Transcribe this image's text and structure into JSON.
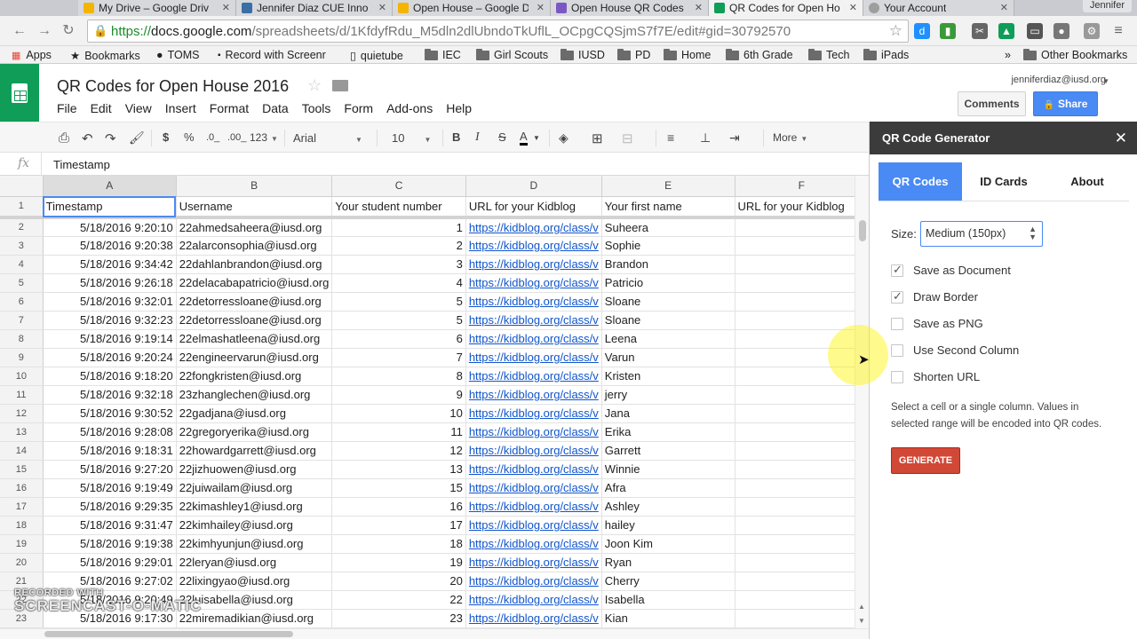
{
  "browser": {
    "tabs": [
      {
        "label": "My Drive – Google Driv",
        "color": "#f4b400"
      },
      {
        "label": "Jennifer Diaz CUE Inno",
        "color": "#3a6ea5"
      },
      {
        "label": "Open House – Google D",
        "color": "#f4b400"
      },
      {
        "label": "Open House QR Codes",
        "color": "#7b57c4"
      },
      {
        "label": "QR Codes for Open Ho",
        "color": "#0f9d58"
      },
      {
        "label": "Your Account",
        "color": "#9e9e9e"
      }
    ],
    "profile": "Jennifer",
    "url": {
      "scheme": "https://",
      "host": "docs.google.com",
      "path": "/spreadsheets/d/1KfdyfRdu_M5dln2dlUbndoTkUflL_OCpgCQSjmS7f7E/edit#gid=30792570"
    },
    "bookmarks": [
      "Apps",
      "Bookmarks",
      "TOMS",
      "Record with Screenr",
      "quietube",
      "IEC",
      "Girl Scouts",
      "IUSD",
      "PD",
      "Home",
      "6th Grade",
      "Tech",
      "iPads"
    ],
    "other_bookmarks": "Other Bookmarks",
    "overflow": "»"
  },
  "sheets": {
    "title": "QR Codes for Open House 2016",
    "menu": [
      "File",
      "Edit",
      "View",
      "Insert",
      "Format",
      "Data",
      "Tools",
      "Form",
      "Add-ons",
      "Help"
    ],
    "account": "jenniferdiaz@iusd.org",
    "comments": "Comments",
    "share": "Share",
    "toolbar": {
      "currency": "$",
      "percent": "%",
      "dec_less": ".0_",
      "dec_more": ".00_",
      "number_format": "123",
      "font": "Arial",
      "font_size": "10",
      "bold": "B",
      "italic": "I",
      "strike": "S",
      "text_color": "A",
      "more": "More"
    },
    "formula_label": "fx",
    "formula_value": "Timestamp",
    "columns": [
      "A",
      "B",
      "C",
      "D",
      "E",
      "F"
    ],
    "header_row": [
      "Timestamp",
      "Username",
      "Your student number",
      "URL for  your Kidblog",
      "Your first name",
      "URL for  your Kidblog"
    ],
    "rows": [
      {
        "n": "2",
        "ts": "5/18/2016 9:20:10",
        "user": "22ahmedsaheera@iusd.org",
        "num": "1",
        "url": "https://kidblog.org/class/v",
        "first": "Suheera"
      },
      {
        "n": "3",
        "ts": "5/18/2016 9:20:38",
        "user": "22alarconsophia@iusd.org",
        "num": "2",
        "url": "https://kidblog.org/class/v",
        "first": "Sophie"
      },
      {
        "n": "4",
        "ts": "5/18/2016 9:34:42",
        "user": "22dahlanbrandon@iusd.org",
        "num": "3",
        "url": "https://kidblog.org/class/v",
        "first": "Brandon"
      },
      {
        "n": "5",
        "ts": "5/18/2016 9:26:18",
        "user": "22delacabapatricio@iusd.org",
        "num": "4",
        "url": "https://kidblog.org/class/v",
        "first": "Patricio"
      },
      {
        "n": "6",
        "ts": "5/18/2016 9:32:01",
        "user": "22detorressloane@iusd.org",
        "num": "5",
        "url": "https://kidblog.org/class/v",
        "first": "Sloane"
      },
      {
        "n": "7",
        "ts": "5/18/2016 9:32:23",
        "user": "22detorressloane@iusd.org",
        "num": "5",
        "url": "https://kidblog.org/class/v",
        "first": "Sloane"
      },
      {
        "n": "8",
        "ts": "5/18/2016 9:19:14",
        "user": "22elmashatleena@iusd.org",
        "num": "6",
        "url": "https://kidblog.org/class/v",
        "first": "Leena"
      },
      {
        "n": "9",
        "ts": "5/18/2016 9:20:24",
        "user": "22engineervarun@iusd.org",
        "num": "7",
        "url": "https://kidblog.org/class/v",
        "first": "Varun"
      },
      {
        "n": "10",
        "ts": "5/18/2016 9:18:20",
        "user": "22fongkristen@iusd.org",
        "num": "8",
        "url": "https://kidblog.org/class/v",
        "first": "Kristen"
      },
      {
        "n": "11",
        "ts": "5/18/2016 9:32:18",
        "user": "23zhanglechen@iusd.org",
        "num": "9",
        "url": "https://kidblog.org/class/v",
        "first": "jerry"
      },
      {
        "n": "12",
        "ts": "5/18/2016 9:30:52",
        "user": "22gadjana@iusd.org",
        "num": "10",
        "url": "https://kidblog.org/class/v",
        "first": "Jana"
      },
      {
        "n": "13",
        "ts": "5/18/2016 9:28:08",
        "user": "22gregoryerika@iusd.org",
        "num": "11",
        "url": "https://kidblog.org/class/v",
        "first": "Erika"
      },
      {
        "n": "14",
        "ts": "5/18/2016 9:18:31",
        "user": "22howardgarrett@iusd.org",
        "num": "12",
        "url": "https://kidblog.org/class/v",
        "first": "Garrett"
      },
      {
        "n": "15",
        "ts": "5/18/2016 9:27:20",
        "user": "22jizhuowen@iusd.org",
        "num": "13",
        "url": "https://kidblog.org/class/v",
        "first": "Winnie"
      },
      {
        "n": "16",
        "ts": "5/18/2016 9:19:49",
        "user": "22juiwailam@iusd.org",
        "num": "15",
        "url": "https://kidblog.org/class/v",
        "first": "Afra"
      },
      {
        "n": "17",
        "ts": "5/18/2016 9:29:35",
        "user": "22kimashley1@iusd.org",
        "num": "16",
        "url": "https://kidblog.org/class/v",
        "first": "Ashley"
      },
      {
        "n": "18",
        "ts": "5/18/2016 9:31:47",
        "user": "22kimhailey@iusd.org",
        "num": "17",
        "url": "https://kidblog.org/class/v",
        "first": "hailey"
      },
      {
        "n": "19",
        "ts": "5/18/2016 9:19:38",
        "user": "22kimhyunjun@iusd.org",
        "num": "18",
        "url": "https://kidblog.org/class/v",
        "first": "Joon Kim"
      },
      {
        "n": "20",
        "ts": "5/18/2016 9:29:01",
        "user": "22leryan@iusd.org",
        "num": "19",
        "url": "https://kidblog.org/class/v",
        "first": "Ryan"
      },
      {
        "n": "21",
        "ts": "5/18/2016 9:27:02",
        "user": "22lixingyao@iusd.org",
        "num": "20",
        "url": "https://kidblog.org/class/v",
        "first": "Cherry"
      },
      {
        "n": "22",
        "ts": "5/18/2016 9:20:49",
        "user": "22luisabella@iusd.org",
        "num": "22",
        "url": "https://kidblog.org/class/v",
        "first": "Isabella"
      },
      {
        "n": "23",
        "ts": "5/18/2016 9:17:30",
        "user": "22miremadikian@iusd.org",
        "num": "23",
        "url": "https://kidblog.org/class/v",
        "first": "Kian"
      }
    ]
  },
  "sidebar": {
    "title": "QR Code Generator",
    "tabs": [
      "QR Codes",
      "ID Cards",
      "About"
    ],
    "size_label": "Size:",
    "size_value": "Medium (150px)",
    "options": [
      {
        "label": "Save as Document",
        "checked": true
      },
      {
        "label": "Draw Border",
        "checked": true
      },
      {
        "label": "Save as PNG",
        "checked": false
      },
      {
        "label": "Use Second Column",
        "checked": false
      },
      {
        "label": "Shorten URL",
        "checked": false
      }
    ],
    "help": "Select a cell or a single column. Values in selected range will be encoded into QR codes.",
    "generate": "GENERATE",
    "accent": "#4a8af4",
    "generate_color": "#d14836"
  },
  "watermark": {
    "line1": "RECORDED WITH",
    "line2": "SCREENCAST-O-MATIC"
  }
}
